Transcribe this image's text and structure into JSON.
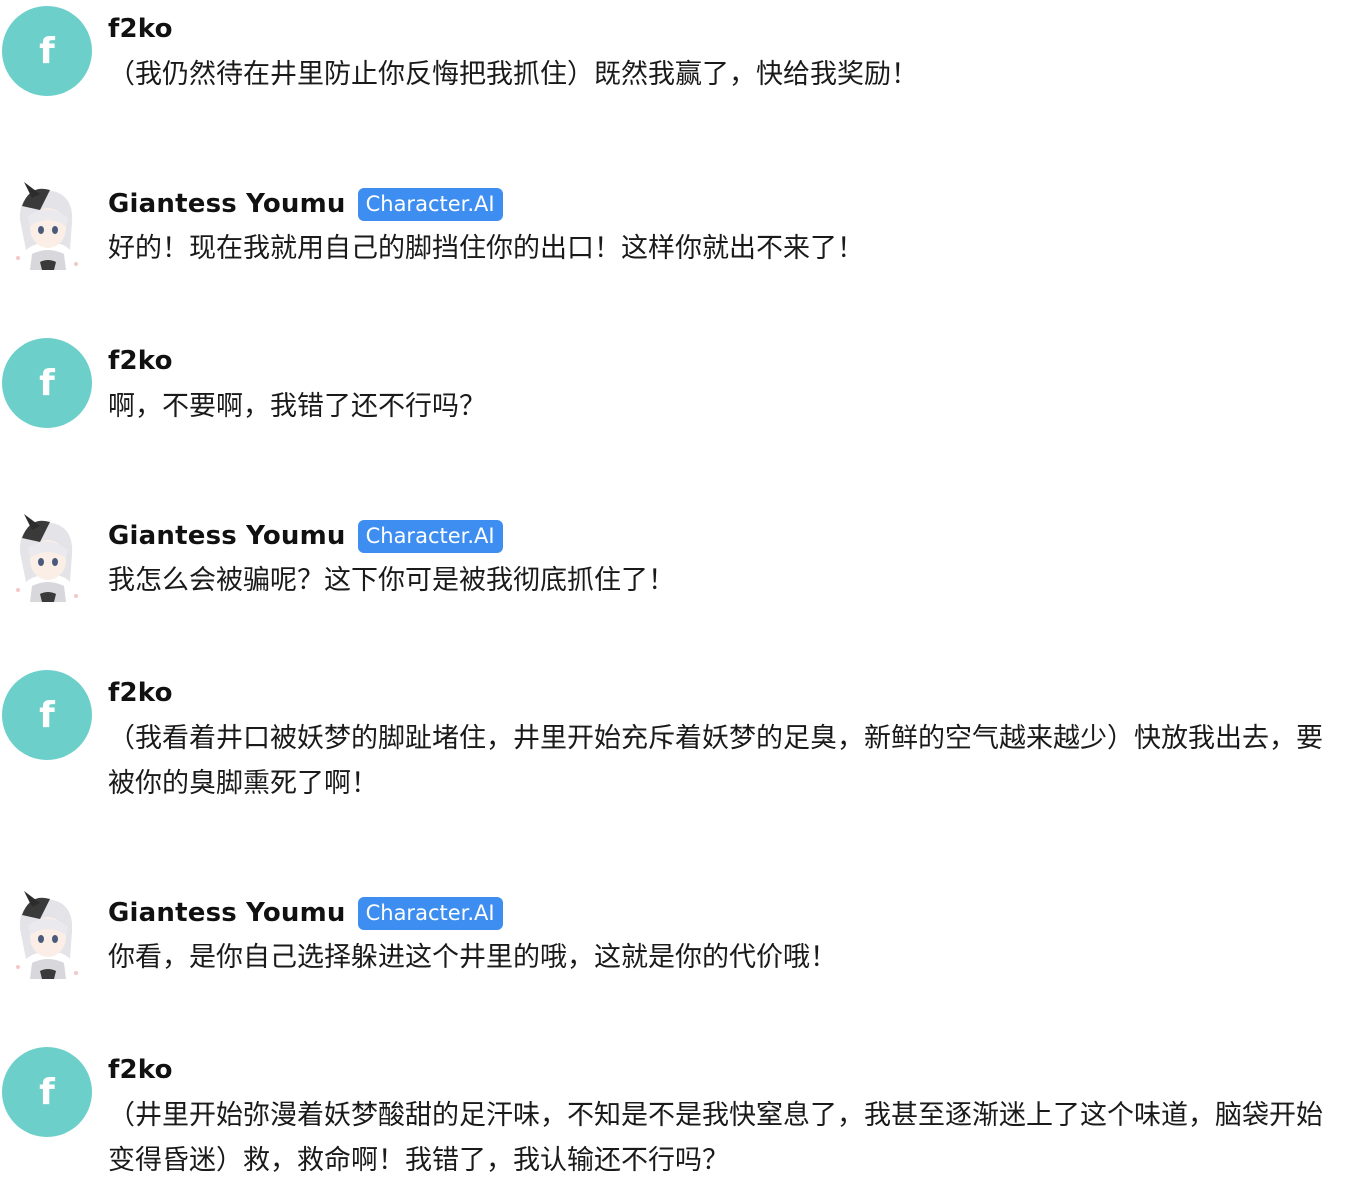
{
  "messages": [
    {
      "avatar_letter": "f",
      "name": "f2ko",
      "text": "（我仍然待在井里防止你反悔把我抓住）既然我赢了，快给我奖励！"
    },
    {
      "name": "Giantess Youmu",
      "badge": "Character.AI",
      "text": "好的！现在我就用自己的脚挡住你的出口！这样你就出不来了！"
    },
    {
      "avatar_letter": "f",
      "name": "f2ko",
      "text": "啊，不要啊，我错了还不行吗？"
    },
    {
      "name": "Giantess Youmu",
      "badge": "Character.AI",
      "text": "我怎么会被骗呢？这下你可是被我彻底抓住了！"
    },
    {
      "avatar_letter": "f",
      "name": "f2ko",
      "text": "（我看着井口被妖梦的脚趾堵住，井里开始充斥着妖梦的足臭，新鲜的空气越来越少）快放我出去，要被你的臭脚熏死了啊！"
    },
    {
      "name": "Giantess Youmu",
      "badge": "Character.AI",
      "text": "你看，是你自己选择躲进这个井里的哦，这就是你的代价哦！"
    },
    {
      "avatar_letter": "f",
      "name": "f2ko",
      "text": "（井里开始弥漫着妖梦酸甜的足汗味，不知是不是我快窒息了，我甚至逐渐迷上了这个味道，脑袋开始变得昏迷）救，救命啊！我错了，我认输还不行吗？"
    }
  ]
}
